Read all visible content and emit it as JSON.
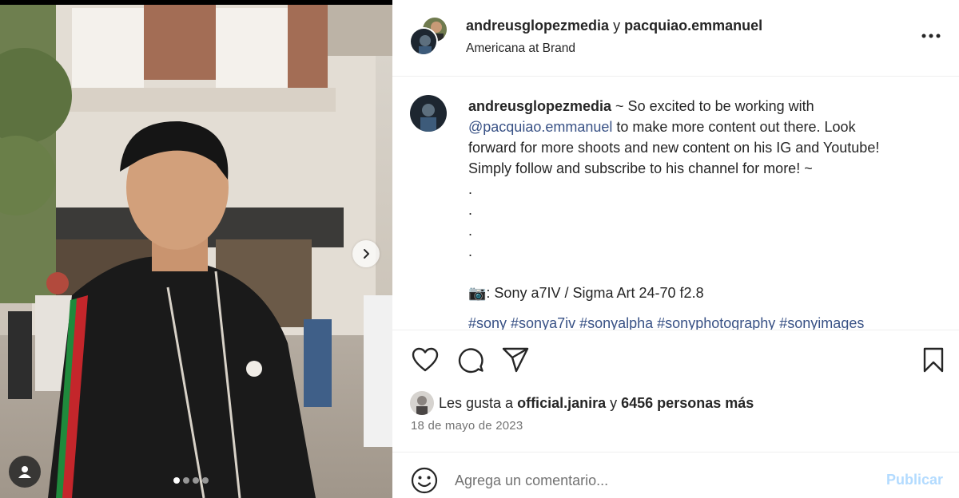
{
  "post": {
    "author": "andreusglopezmedia",
    "conjunction": "y",
    "collaborator": "pacquiao.emmanuel",
    "location": "Americana at Brand"
  },
  "caption": {
    "user": "andreusglopezmedia",
    "text_1": " ~ So excited to be working with",
    "mention": "@pacquiao.emmanuel",
    "text_2": " to make more content out there. Look",
    "line_3": "forward for more shoots and new content on his IG and Youtube!",
    "line_4": "Simply follow and subscribe to his channel for more! ~",
    "dot_lines": [
      ".",
      ".",
      ".",
      "."
    ],
    "camera_emoji": "📷",
    "gear": ": Sony a7IV / Sigma Art 24-70 f2.8",
    "hashtags": "#sony #sonya7iv #sonyalpha #sonyphotography #sonyimages"
  },
  "likes": {
    "prefix": "Les gusta a ",
    "user": "official.janira",
    "middle": " y ",
    "count_text": "6456 personas más"
  },
  "date": "18 de mayo de 2023",
  "comment": {
    "placeholder": "Agrega un comentario...",
    "post_label": "Publicar"
  },
  "carousel": {
    "total": 4,
    "current": 1
  },
  "colors": {
    "link": "#385185",
    "muted": "#737373",
    "publish_disabled": "#b3dbff",
    "divider": "#efefef"
  },
  "icons": [
    "more-options-icon",
    "heart-icon",
    "comment-icon",
    "share-icon",
    "bookmark-icon",
    "emoji-icon",
    "chevron-right-icon",
    "user-tag-icon"
  ]
}
